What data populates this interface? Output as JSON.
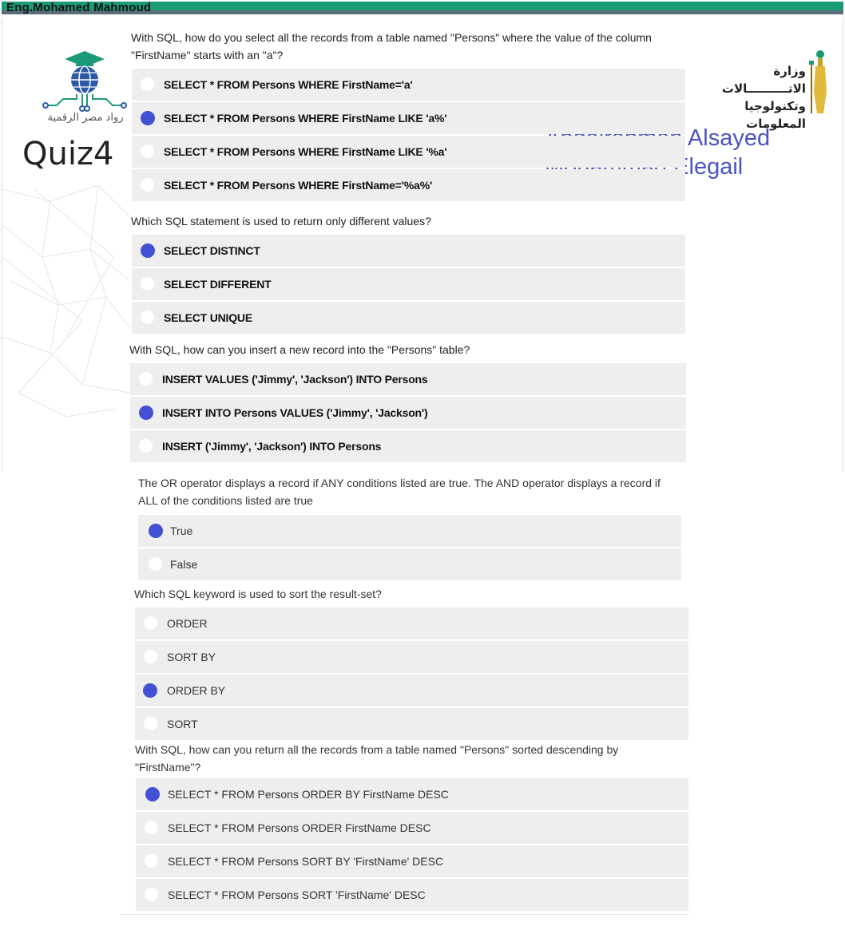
{
  "header": {
    "author": "Eng.Mohamed Mahmoud"
  },
  "logo_left": {
    "text": "رواد مصر الرقمية"
  },
  "quiz_title": "Quiz4",
  "logo_right": {
    "line1": "وزارة الاتــــــــــالات",
    "line2": "وتكنولوجيا المعلومات"
  },
  "names": {
    "line1": "Abdalrahman Alsayed",
    "line2": "Mohammad Elegail"
  },
  "questions": [
    {
      "text": "With SQL, how do you select all the records from a table named \"Persons\" where the value of the column \"FirstName\" starts with an \"a\"?",
      "selected": 1,
      "options": [
        "SELECT * FROM Persons WHERE FirstName='a'",
        "SELECT * FROM Persons WHERE FirstName LIKE 'a%'",
        "SELECT * FROM Persons WHERE FirstName LIKE '%a'",
        "SELECT * FROM Persons WHERE FirstName='%a%'"
      ]
    },
    {
      "text": "Which SQL statement is used to return only different values?",
      "selected": 0,
      "options": [
        "SELECT DISTINCT",
        "SELECT DIFFERENT",
        "SELECT UNIQUE"
      ]
    },
    {
      "text": "With SQL, how can you insert a new record into the \"Persons\" table?",
      "selected": 1,
      "options": [
        "INSERT VALUES ('Jimmy', 'Jackson') INTO Persons",
        "INSERT INTO Persons VALUES ('Jimmy', 'Jackson')",
        "INSERT ('Jimmy', 'Jackson') INTO Persons"
      ]
    },
    {
      "text": "The OR operator displays a record if ANY conditions listed are true. The AND operator displays a record if ALL of the conditions listed are true",
      "selected": 0,
      "options": [
        "True",
        "False"
      ]
    },
    {
      "text": "Which SQL keyword is used to sort the result-set?",
      "selected": 2,
      "options": [
        "ORDER",
        "SORT BY",
        "ORDER BY",
        "SORT"
      ]
    },
    {
      "text": "With SQL, how can you return all the records from a table named \"Persons\" sorted descending by \"FirstName\"?",
      "selected": 0,
      "options": [
        "SELECT * FROM Persons ORDER BY FirstName DESC",
        "SELECT * FROM Persons ORDER FirstName DESC",
        "SELECT * FROM Persons SORT BY 'FirstName' DESC",
        "SELECT * FROM Persons SORT 'FirstName' DESC"
      ]
    }
  ],
  "colors": {
    "selected_radio": "#4350d4",
    "option_bg": "#eeeeee",
    "names_text": "#4b53c4",
    "header_stripe": "#1a9a76"
  }
}
